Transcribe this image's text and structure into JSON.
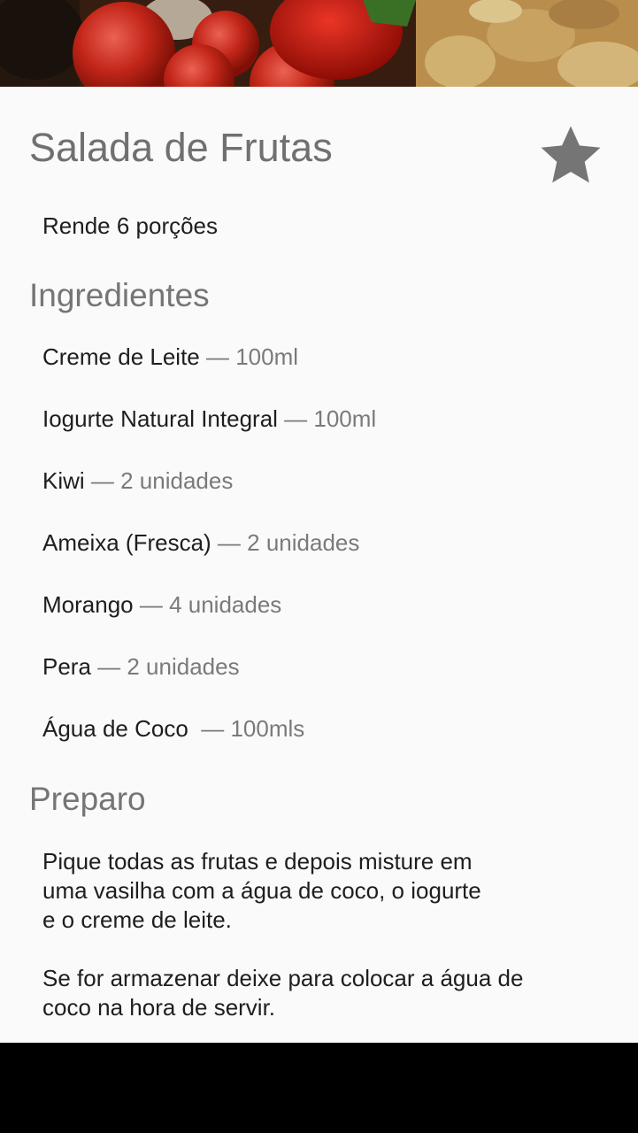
{
  "recipe": {
    "title": "Salada de Frutas",
    "servings": "Rende 6 porções",
    "favorite_icon": "star-icon"
  },
  "sections": {
    "ingredients_title": "Ingredientes",
    "preparo_title": "Preparo"
  },
  "ingredients": [
    {
      "name": "Creme de Leite",
      "qty": "100ml"
    },
    {
      "name": "Iogurte Natural Integral",
      "qty": "100ml"
    },
    {
      "name": "Kiwi",
      "qty": "2 unidades"
    },
    {
      "name": "Ameixa (Fresca)",
      "qty": "2 unidades"
    },
    {
      "name": "Morango",
      "qty": "4 unidades"
    },
    {
      "name": "Pera",
      "qty": "2 unidades"
    },
    {
      "name": "Água de Coco ",
      "qty": "100mls"
    }
  ],
  "separator": " — ",
  "preparo": {
    "paragraph_1": "Pique todas as frutas e depois misture em\numa vasilha com a água de coco, o iogurte\ne o creme de leite.",
    "paragraph_2": "Se for armazenar deixe para colocar a água de\ncoco na hora de servir."
  },
  "colors": {
    "background": "#fafafa",
    "title": "#707070",
    "text": "#1e1e1e",
    "secondary": "#7a7a7a",
    "star": "#757575"
  }
}
